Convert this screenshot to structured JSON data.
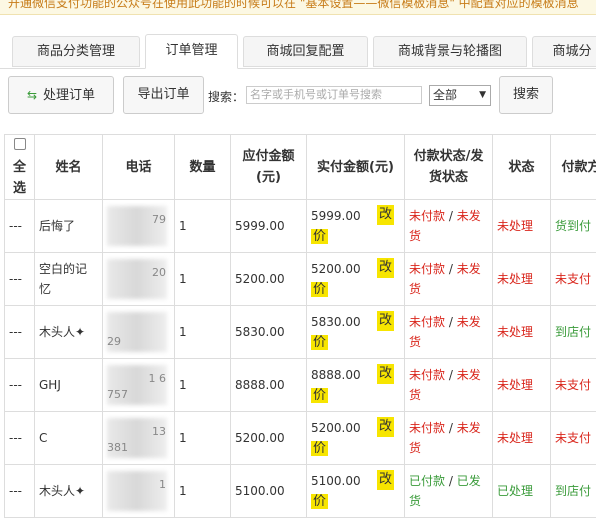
{
  "notice": {
    "text": "开通微信支付功能的公众号在使用此功能的时候可以在 \"基本设置——微信模板消息\" 中配置对应的模板消息"
  },
  "tabs": [
    {
      "label": "商品分类管理",
      "active": false
    },
    {
      "label": "订单管理",
      "active": true
    },
    {
      "label": "商城回复配置",
      "active": false
    },
    {
      "label": "商城背景与轮播图",
      "active": false
    },
    {
      "label": "商城分",
      "active": false
    }
  ],
  "toolbar": {
    "process_label": "处理订单",
    "export_label": "导出订单",
    "search_label": "搜索：",
    "search_placeholder": "名字或手机号或订单号搜索",
    "filter_value": "全部",
    "search_button": "搜索"
  },
  "table": {
    "headers": [
      "全选",
      "姓名",
      "电话",
      "数量",
      "应付金额(元)",
      "实付金额(元)",
      "付款状态/发货状态",
      "状态",
      "付款方式"
    ],
    "modify_label": "改价",
    "rows": [
      {
        "sel": "---",
        "name": "后悔了",
        "phone_a": "79",
        "phone_b": "",
        "qty": "1",
        "due": "5999.00",
        "paid": "5999.00",
        "pay": "未付款",
        "ship": "未发货",
        "status": "未处理",
        "method": "货到付"
      },
      {
        "sel": "---",
        "name": "空白的记忆",
        "phone_a": "20",
        "phone_b": "",
        "qty": "1",
        "due": "5200.00",
        "paid": "5200.00",
        "pay": "未付款",
        "ship": "未发货",
        "status": "未处理",
        "method": "未支付"
      },
      {
        "sel": "---",
        "name": "木头人✦",
        "phone_a": "",
        "phone_b": "29",
        "qty": "1",
        "due": "5830.00",
        "paid": "5830.00",
        "pay": "未付款",
        "ship": "未发货",
        "status": "未处理",
        "method": "到店付"
      },
      {
        "sel": "---",
        "name": "GHJ",
        "phone_a": "1 6",
        "phone_b": "757",
        "qty": "1",
        "due": "8888.00",
        "paid": "8888.00",
        "pay": "未付款",
        "ship": "未发货",
        "status": "未处理",
        "method": "未支付"
      },
      {
        "sel": "---",
        "name": "C",
        "phone_a": "13",
        "phone_b": "381",
        "qty": "1",
        "due": "5200.00",
        "paid": "5200.00",
        "pay": "未付款",
        "ship": "未发货",
        "status": "未处理",
        "method": "未支付"
      },
      {
        "sel": "---",
        "name": "木头人✦",
        "phone_a": "1",
        "phone_b": "",
        "qty": "1",
        "due": "5100.00",
        "paid": "5100.00",
        "pay": "已付款",
        "ship": "已发货",
        "status": "已处理",
        "method": "到店付"
      }
    ]
  },
  "colors": {
    "accent_red": "#d9261c",
    "accent_green": "#3a9b3a",
    "highlight": "#f7e500"
  }
}
